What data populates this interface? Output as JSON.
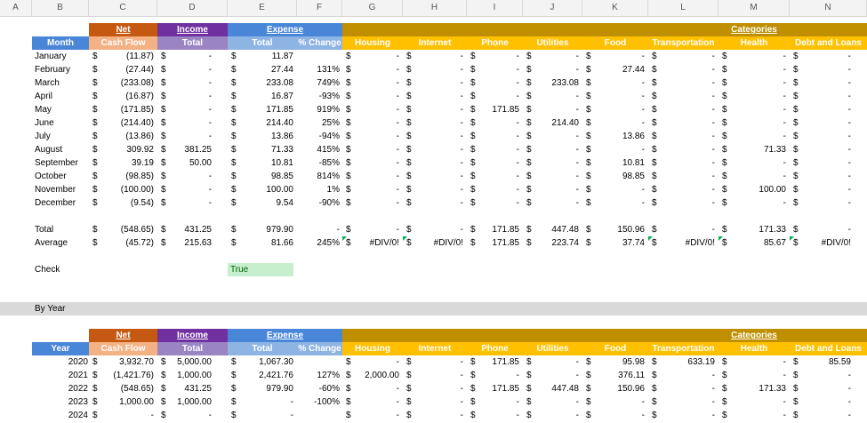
{
  "colors": {
    "net_dark": "#c65911",
    "net_light": "#f4b183",
    "income_dark": "#7030a0",
    "income_light": "#9a84c2",
    "expense_dark": "#4a86d8",
    "expense_light": "#8eb4e3",
    "cat_dark": "#bf8f00",
    "cat_light": "#ffc000",
    "check_true": "#c6efce"
  },
  "column_letters": [
    "A",
    "B",
    "C",
    "D",
    "E",
    "F",
    "G",
    "H",
    "I",
    "J",
    "K",
    "L",
    "M",
    "N"
  ],
  "group_headers": {
    "net": "Net",
    "income": "Income",
    "expense": "Expense",
    "categories": "Categories"
  },
  "monthly": {
    "sub_headers": {
      "first": "Month",
      "net": "Cash Flow",
      "income": "Total",
      "expense": "Total",
      "pct": "% Change",
      "cats": [
        "Housing",
        "Internet",
        "Phone",
        "Utilities",
        "Food",
        "Transportation",
        "Health",
        "Debt and Loans"
      ]
    },
    "rows": [
      {
        "label": "January",
        "net": "(11.87)",
        "income": "-",
        "expense": "11.87",
        "pct": "",
        "cats": [
          "-",
          "-",
          "-",
          "-",
          "-",
          "-",
          "-",
          "-"
        ]
      },
      {
        "label": "February",
        "net": "(27.44)",
        "income": "-",
        "expense": "27.44",
        "pct": "131%",
        "cats": [
          "-",
          "-",
          "-",
          "-",
          "27.44",
          "-",
          "-",
          "-"
        ]
      },
      {
        "label": "March",
        "net": "(233.08)",
        "income": "-",
        "expense": "233.08",
        "pct": "749%",
        "cats": [
          "-",
          "-",
          "-",
          "233.08",
          "-",
          "-",
          "-",
          "-"
        ]
      },
      {
        "label": "April",
        "net": "(16.87)",
        "income": "-",
        "expense": "16.87",
        "pct": "-93%",
        "cats": [
          "-",
          "-",
          "-",
          "-",
          "-",
          "-",
          "-",
          "-"
        ]
      },
      {
        "label": "May",
        "net": "(171.85)",
        "income": "-",
        "expense": "171.85",
        "pct": "919%",
        "cats": [
          "-",
          "-",
          "171.85",
          "-",
          "-",
          "-",
          "-",
          "-"
        ]
      },
      {
        "label": "June",
        "net": "(214.40)",
        "income": "-",
        "expense": "214.40",
        "pct": "25%",
        "cats": [
          "-",
          "-",
          "-",
          "214.40",
          "-",
          "-",
          "-",
          "-"
        ]
      },
      {
        "label": "July",
        "net": "(13.86)",
        "income": "-",
        "expense": "13.86",
        "pct": "-94%",
        "cats": [
          "-",
          "-",
          "-",
          "-",
          "13.86",
          "-",
          "-",
          "-"
        ]
      },
      {
        "label": "August",
        "net": "309.92",
        "income": "381.25",
        "expense": "71.33",
        "pct": "415%",
        "cats": [
          "-",
          "-",
          "-",
          "-",
          "-",
          "-",
          "71.33",
          "-"
        ]
      },
      {
        "label": "September",
        "net": "39.19",
        "income": "50.00",
        "expense": "10.81",
        "pct": "-85%",
        "cats": [
          "-",
          "-",
          "-",
          "-",
          "10.81",
          "-",
          "-",
          "-"
        ]
      },
      {
        "label": "October",
        "net": "(98.85)",
        "income": "-",
        "expense": "98.85",
        "pct": "814%",
        "cats": [
          "-",
          "-",
          "-",
          "-",
          "98.85",
          "-",
          "-",
          "-"
        ]
      },
      {
        "label": "November",
        "net": "(100.00)",
        "income": "-",
        "expense": "100.00",
        "pct": "1%",
        "cats": [
          "-",
          "-",
          "-",
          "-",
          "-",
          "-",
          "100.00",
          "-"
        ]
      },
      {
        "label": "December",
        "net": "(9.54)",
        "income": "-",
        "expense": "9.54",
        "pct": "-90%",
        "cats": [
          "-",
          "-",
          "-",
          "-",
          "-",
          "-",
          "-",
          "-"
        ]
      }
    ],
    "total": {
      "label": "Total",
      "net": "(548.65)",
      "income": "431.25",
      "expense": "979.90",
      "pct": "-",
      "cats": [
        "-",
        "-",
        "171.85",
        "447.48",
        "150.96",
        "-",
        "171.33",
        "-"
      ]
    },
    "average": {
      "label": "Average",
      "net": "(45.72)",
      "income": "215.63",
      "expense": "81.66",
      "pct": "245%",
      "cats": [
        "#DIV/0!",
        "#DIV/0!",
        "171.85",
        "223.74",
        "37.74",
        "#DIV/0!",
        "85.67",
        "#DIV/0!"
      ]
    }
  },
  "check": {
    "label": "Check",
    "value": "True"
  },
  "by_year_label": "By Year",
  "yearly": {
    "sub_headers": {
      "first": "Year",
      "net": "Cash Flow",
      "income": "Total",
      "expense": "Total",
      "pct": "% Change",
      "cats": [
        "Housing",
        "Internet",
        "Phone",
        "Utilities",
        "Food",
        "Transportation",
        "Health",
        "Debt and Loans"
      ]
    },
    "rows": [
      {
        "label": "2020",
        "net": "3,932.70",
        "income": "5,000.00",
        "expense": "1,067.30",
        "pct": "",
        "cats": [
          "-",
          "-",
          "171.85",
          "-",
          "95.98",
          "633.19",
          "-",
          "85.59"
        ]
      },
      {
        "label": "2021",
        "net": "(1,421.76)",
        "income": "1,000.00",
        "expense": "2,421.76",
        "pct": "127%",
        "cats": [
          "2,000.00",
          "-",
          "-",
          "-",
          "376.11",
          "-",
          "-",
          "-"
        ]
      },
      {
        "label": "2022",
        "net": "(548.65)",
        "income": "431.25",
        "expense": "979.90",
        "pct": "-60%",
        "cats": [
          "-",
          "-",
          "171.85",
          "447.48",
          "150.96",
          "-",
          "171.33",
          "-"
        ]
      },
      {
        "label": "2023",
        "net": "1,000.00",
        "income": "1,000.00",
        "expense": "-",
        "pct": "-100%",
        "cats": [
          "-",
          "-",
          "-",
          "-",
          "-",
          "-",
          "-",
          "-"
        ]
      },
      {
        "label": "2024",
        "net": "-",
        "income": "-",
        "expense": "-",
        "pct": "",
        "cats": [
          "-",
          "-",
          "-",
          "-",
          "-",
          "-",
          "-",
          "-"
        ]
      }
    ]
  },
  "currency_symbol": "$"
}
